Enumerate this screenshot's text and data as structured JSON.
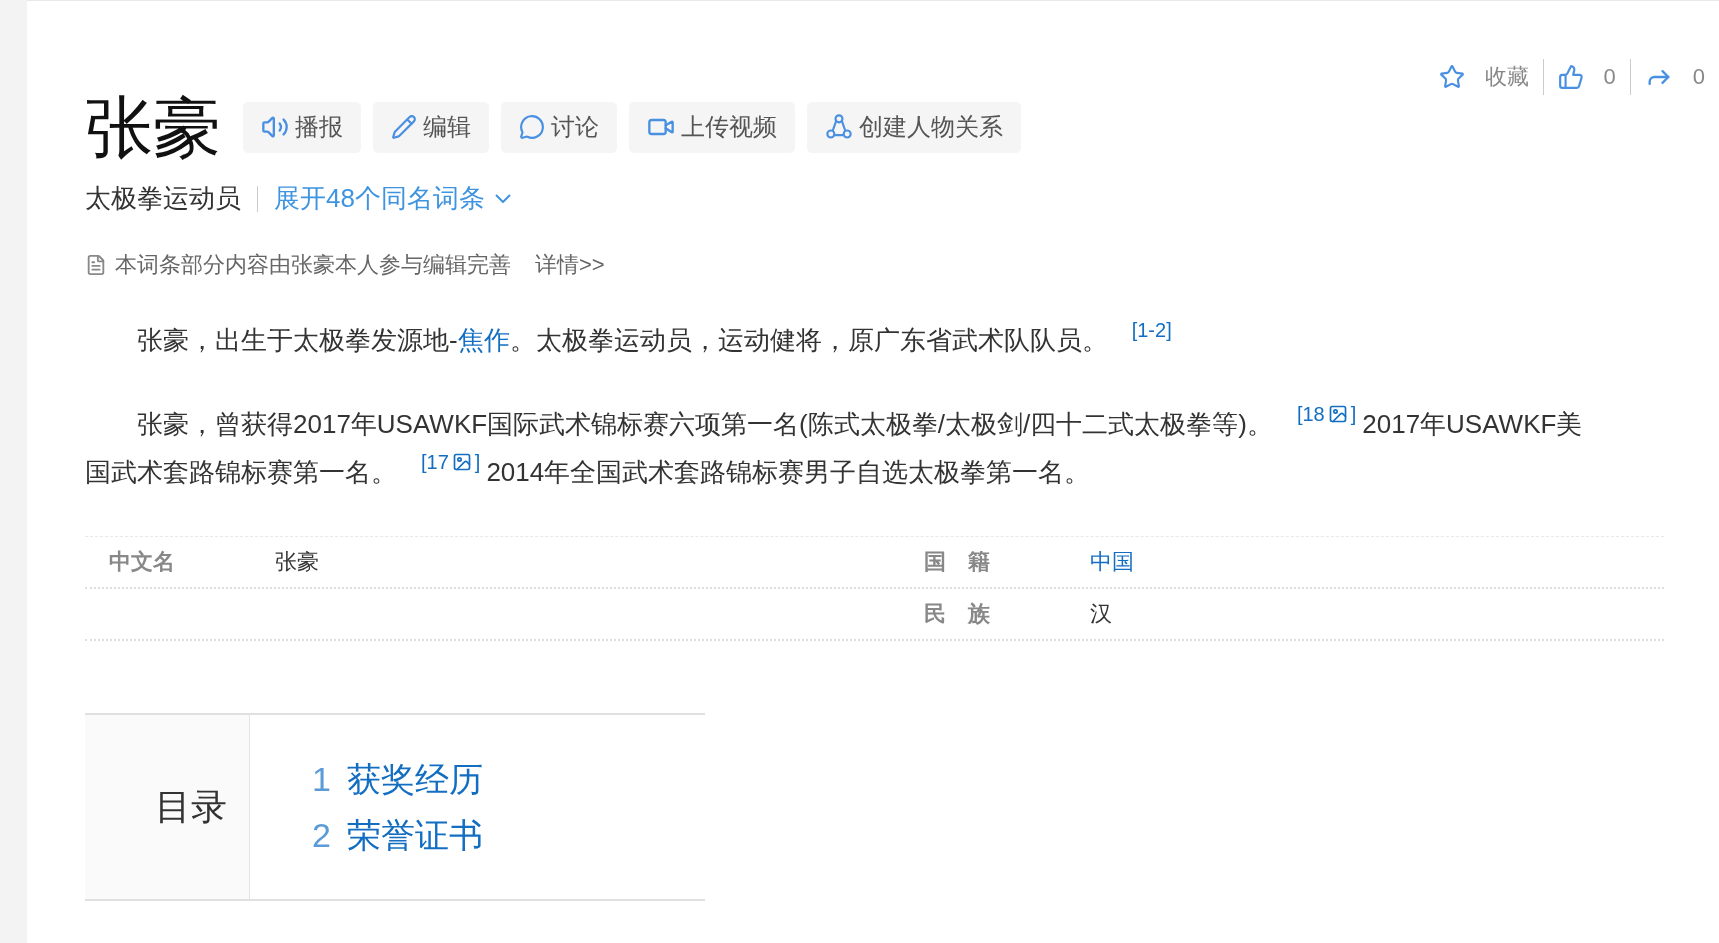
{
  "title": "张豪",
  "title_buttons": [
    "播报",
    "编辑",
    "讨论",
    "上传视频",
    "创建人物关系"
  ],
  "actions": {
    "favorite": "收藏",
    "likes": "0",
    "shares": "0"
  },
  "subtitle": {
    "description": "太极拳运动员",
    "expand_link": "展开48个同名词条"
  },
  "notice": {
    "text": "本词条部分内容由张豪本人参与编辑完善",
    "link": "详情>>"
  },
  "paragraphs": [
    {
      "segments": [
        {
          "kind": "text",
          "text": "张豪，出生于太极拳发源地-"
        },
        {
          "kind": "link",
          "text": "焦作"
        },
        {
          "kind": "text",
          "text": "。太极拳运动员，运动健将，原广东省武术队队员。"
        },
        {
          "kind": "ref",
          "text": "[1-2]"
        }
      ]
    },
    {
      "segments": [
        {
          "kind": "text",
          "text": "张豪，曾获得2017年USAWKF国际武术锦标赛六项第一名(陈式太极拳/太极剑/四十二式太极拳等)。"
        },
        {
          "kind": "ref",
          "text": "[18",
          "image": true,
          "close": "]"
        },
        {
          "kind": "text",
          "text": "2017年USAWKF美国武术套路锦标赛第一名。"
        },
        {
          "kind": "ref",
          "text": "[17",
          "image": true,
          "close": "]"
        },
        {
          "kind": "text",
          "text": "2014年全国武术套路锦标赛男子自选太极拳第一名。"
        }
      ]
    }
  ],
  "infobox": {
    "rows": [
      {
        "cells": [
          {
            "label": "中文名",
            "value": "张豪",
            "link": false
          },
          {
            "label": "国　籍",
            "value": "中国",
            "link": true
          }
        ]
      },
      {
        "cells": [
          null,
          {
            "label": "民　族",
            "value": "汉",
            "link": false
          }
        ]
      }
    ]
  },
  "toc": {
    "heading": "目录",
    "items": [
      {
        "number": "1",
        "text": "获奖经历"
      },
      {
        "number": "2",
        "text": "荣誉证书"
      }
    ]
  }
}
